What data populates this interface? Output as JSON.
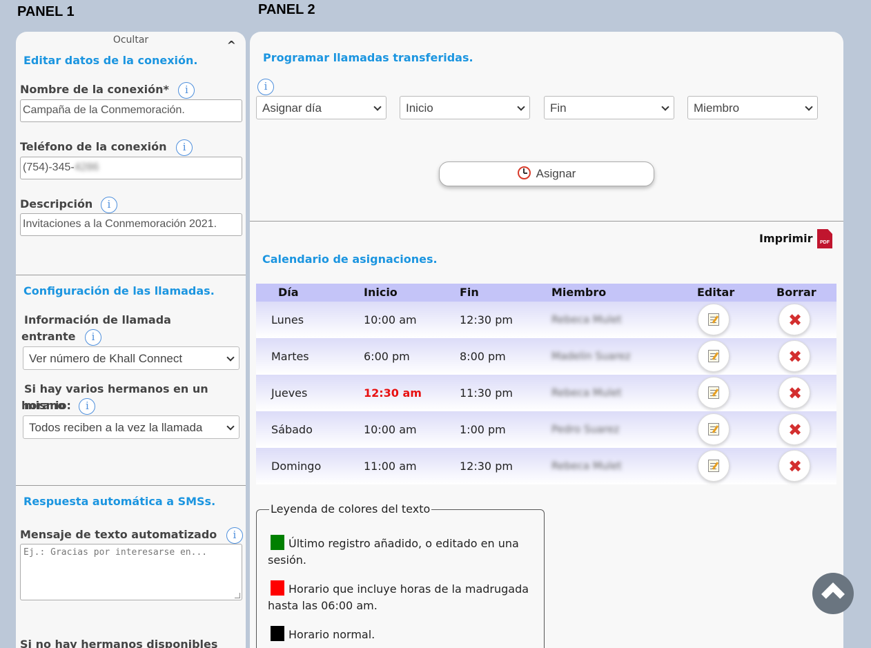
{
  "headings": {
    "panel1": "PANEL 1",
    "panel2": "PANEL 2"
  },
  "panel1": {
    "hide_label": "Ocultar",
    "caret_glyph": "^",
    "connection": {
      "title": "Editar datos de la conexión.",
      "name_label": "Nombre de la conexión*",
      "name_value": "Campaña de la Conmemoración.",
      "phone_label": "Teléfono de la conexión",
      "phone_value_visible": "(754)-345-",
      "phone_value_blurred": "4286",
      "description_label": "Descripción",
      "description_value": "Invitaciones a la Conmemoración 2021."
    },
    "calls": {
      "title": "Configuración de las llamadas.",
      "incoming_label_line1": "Información de llamada",
      "incoming_label_line2": "entrante",
      "incoming_selected": "Ver número de Khall Connect",
      "multi_label_line1": "Si hay varios hermanos en un mismo",
      "multi_label_line2": "horario:",
      "multi_selected": "Todos reciben a la vez la llamada"
    },
    "sms": {
      "title": "Respuesta automática a SMSs.",
      "message_label": "Mensaje de texto automatizado",
      "message_placeholder": "Ej.: Gracias por interesarse en...",
      "no_brothers_label": "Si no hay hermanos disponibles"
    }
  },
  "panel2": {
    "schedule_title": "Programar llamadas transferidas.",
    "selects": {
      "day": "Asignar día",
      "start": "Inicio",
      "end": "Fin",
      "member": "Miembro"
    },
    "assign_label": "Asignar",
    "print_label": "Imprimir",
    "pdf_text": "PDF",
    "calendar_title": "Calendario de asignaciones.",
    "table": {
      "headers": {
        "day": "Día",
        "start": "Inicio",
        "end": "Fin",
        "member": "Miembro",
        "edit": "Editar",
        "delete": "Borrar"
      },
      "rows": [
        {
          "day": "Lunes",
          "start": "10:00 am",
          "end": "12:30 pm",
          "member": "Rebeca Mulet"
        },
        {
          "day": "Martes",
          "start": "6:00 pm",
          "end": "8:00 pm",
          "member": "Madelin Suarez"
        },
        {
          "day": "Jueves",
          "start": "12:30 am",
          "end": "11:30 pm",
          "member": "Rebeca Mulet"
        },
        {
          "day": "Sábado",
          "start": "10:00 am",
          "end": "1:00 pm",
          "member": "Pedro Suarez"
        },
        {
          "day": "Domingo",
          "start": "11:00 am",
          "end": "12:30 pm",
          "member": "Rebeca Mulet"
        }
      ]
    },
    "legend": {
      "title": "Leyenda de colores del texto",
      "items": [
        {
          "color": "#008000",
          "line1": "Último registro añadido, o editado en una",
          "line2": "sesión."
        },
        {
          "color": "#ff0000",
          "line1": "Horario que incluye horas de la madrugada",
          "line2": "hasta las 06:00 am."
        },
        {
          "color": "#000000",
          "line1": "Horario normal.",
          "line2": ""
        }
      ]
    }
  },
  "colors": {
    "accent": "#1b95e0",
    "early_hours": "#e81010",
    "table_header": "#c4c4f8"
  },
  "icons": [
    "info-icon",
    "chevron-down-icon",
    "alarm-clock-icon",
    "pdf-icon",
    "edit-icon",
    "delete-icon",
    "scroll-top-icon"
  ]
}
